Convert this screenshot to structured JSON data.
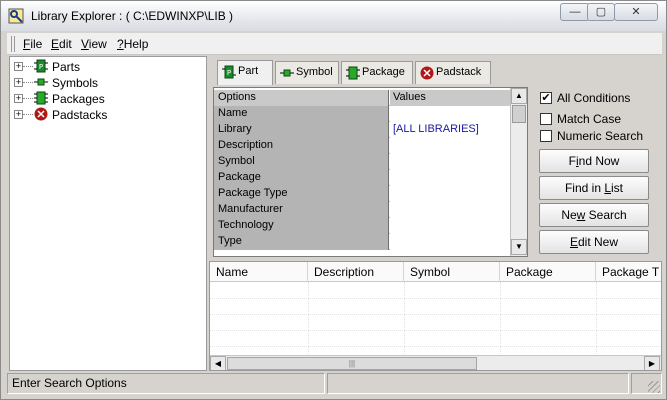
{
  "window": {
    "title": "Library Explorer : ( C:\\EDWINXP\\LIB )"
  },
  "title_buttons": {
    "minimize": "—",
    "maximize": "▢",
    "close": "✕"
  },
  "menu": [
    {
      "key": "F",
      "rest": "ile"
    },
    {
      "key": "E",
      "rest": "dit"
    },
    {
      "key": "V",
      "rest": "iew"
    },
    {
      "key": "?",
      "rest": "Help"
    }
  ],
  "tree": [
    {
      "label": "Parts",
      "icon": "part-icon"
    },
    {
      "label": "Symbols",
      "icon": "symbol-icon"
    },
    {
      "label": "Packages",
      "icon": "package-icon"
    },
    {
      "label": "Padstacks",
      "icon": "padstack-icon"
    }
  ],
  "tabs": [
    "Part",
    "Symbol",
    "Package",
    "Padstack"
  ],
  "grid": {
    "header": {
      "option": "Options",
      "value": "Values"
    },
    "rows": [
      {
        "option": "Name",
        "value": ""
      },
      {
        "option": "Library",
        "value": "[ALL LIBRARIES]"
      },
      {
        "option": "Description",
        "value": ""
      },
      {
        "option": "Symbol",
        "value": ""
      },
      {
        "option": "Package",
        "value": ""
      },
      {
        "option": "Package Type",
        "value": ""
      },
      {
        "option": "Manufacturer",
        "value": ""
      },
      {
        "option": "Technology",
        "value": ""
      },
      {
        "option": "Type",
        "value": ""
      }
    ]
  },
  "options": [
    {
      "label": "All Conditions",
      "checked": true
    },
    {
      "label": "Match Case",
      "checked": false
    },
    {
      "label": "Numeric Search",
      "checked": false
    }
  ],
  "buttons": [
    {
      "pre": "F",
      "key": "i",
      "post": "nd Now"
    },
    {
      "pre": "Find in ",
      "key": "L",
      "post": "ist"
    },
    {
      "pre": "Ne",
      "key": "w",
      "post": " Search"
    },
    {
      "pre": "",
      "key": "E",
      "post": "dit New"
    }
  ],
  "results": {
    "columns": [
      "Name",
      "Description",
      "Symbol",
      "Package",
      "Package T"
    ]
  },
  "status": {
    "text": "Enter Search Options"
  },
  "colors": {
    "part": "#1a8a2a",
    "padstack": "#b01818",
    "link": "#1a1aa0"
  }
}
